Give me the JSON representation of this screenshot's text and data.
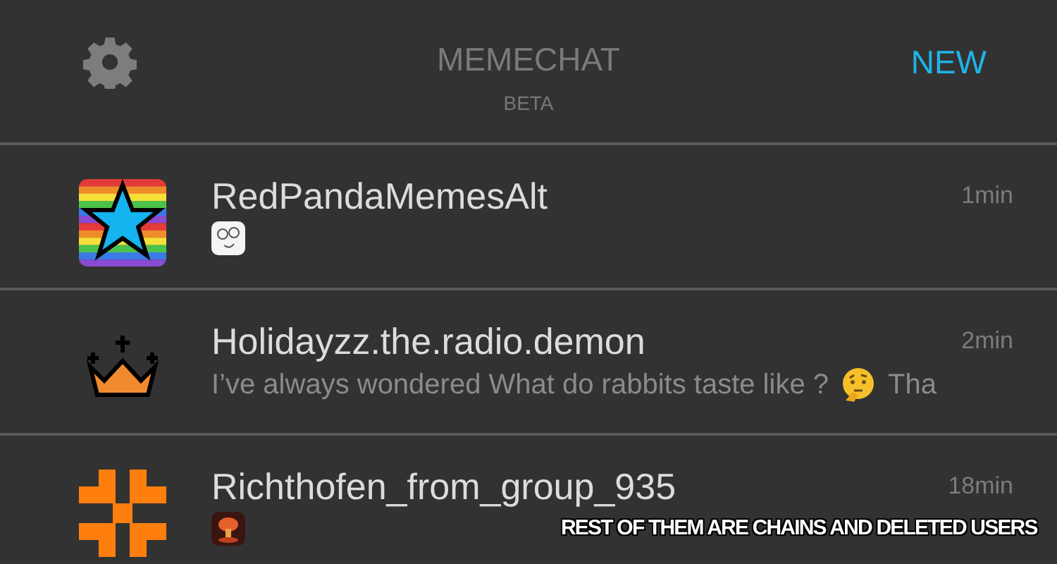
{
  "header": {
    "title": "MEMECHAT",
    "subtitle": "BETA",
    "new_button": "NEW"
  },
  "chats": [
    {
      "avatar": {
        "kind": "star"
      },
      "name": "RedPandaMemesAlt",
      "time": "1min",
      "message": [
        {
          "kind": "face"
        }
      ]
    },
    {
      "avatar": {
        "kind": "crown"
      },
      "name": "Holidayzz.the.radio.demon",
      "time": "2min",
      "message": [
        {
          "kind": "text",
          "text": "I’ve always wondered What do rabbits taste like ?"
        },
        {
          "kind": "thinking"
        },
        {
          "kind": "text",
          "text": "Tha"
        }
      ]
    },
    {
      "avatar": {
        "kind": "cross"
      },
      "name": "Richthofen_from_group_935",
      "time": "18min",
      "message": [
        {
          "kind": "blast"
        }
      ]
    }
  ],
  "caption": "REST OF THEM ARE CHAINS AND DELETED USERS"
}
